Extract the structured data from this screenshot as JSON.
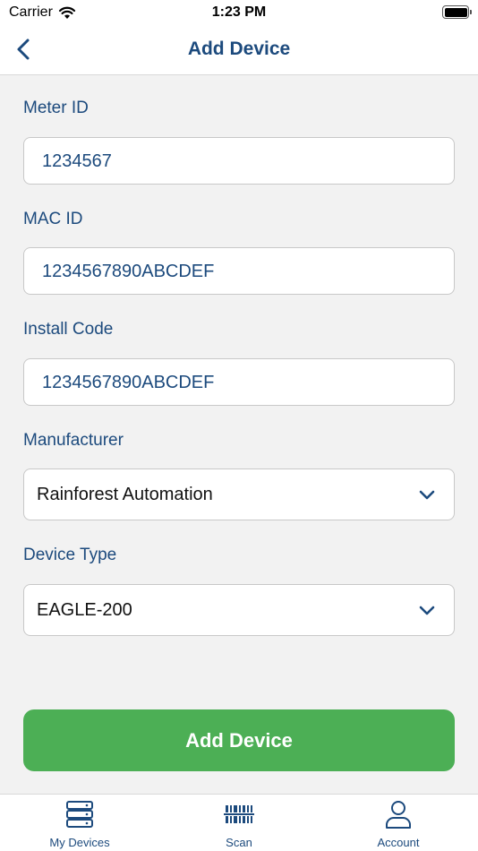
{
  "status_bar": {
    "carrier": "Carrier",
    "time": "1:23 PM"
  },
  "nav": {
    "title": "Add Device"
  },
  "form": {
    "meter_id": {
      "label": "Meter ID",
      "value": "1234567"
    },
    "mac_id": {
      "label": "MAC ID",
      "value": "1234567890ABCDEF"
    },
    "install_code": {
      "label": "Install Code",
      "value": "1234567890ABCDEF"
    },
    "manufacturer": {
      "label": "Manufacturer",
      "value": "Rainforest Automation"
    },
    "device_type": {
      "label": "Device Type",
      "value": "EAGLE-200"
    }
  },
  "actions": {
    "add_device_label": "Add Device"
  },
  "tabs": [
    {
      "label": "My Devices",
      "icon": "server-icon"
    },
    {
      "label": "Scan",
      "icon": "barcode-icon"
    },
    {
      "label": "Account",
      "icon": "person-icon"
    }
  ],
  "colors": {
    "accent": "#1c4a7d",
    "primary_button": "#4caf55",
    "background": "#f2f2f2"
  }
}
